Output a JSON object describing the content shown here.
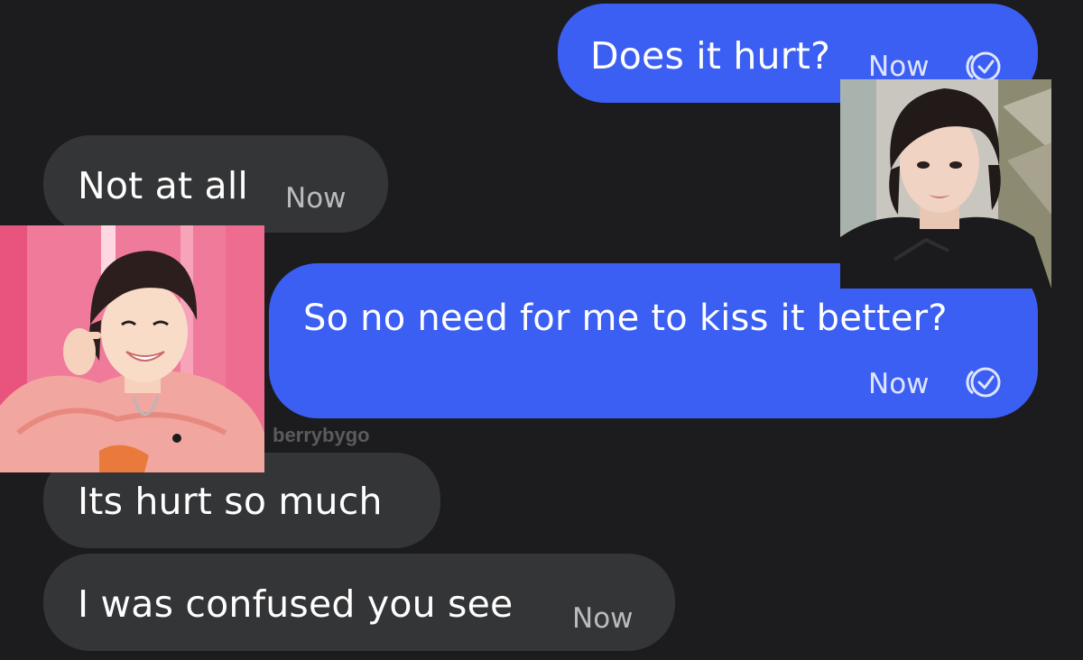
{
  "conversation": {
    "messages": [
      {
        "direction": "sent",
        "text": "Does it hurt?",
        "time": "Now",
        "status_icon": "read-check-icon"
      },
      {
        "direction": "received",
        "text": "Not at all",
        "time": "Now"
      },
      {
        "direction": "sent",
        "text": "So no need for me to kiss it better?",
        "time": "Now",
        "status_icon": "read-check-icon"
      },
      {
        "direction": "received",
        "text": "Its hurt so much",
        "time": ""
      },
      {
        "direction": "received",
        "text": "I was confused you see",
        "time": "Now"
      }
    ]
  },
  "overlay": {
    "watermark": "berrybygo",
    "images": [
      {
        "name": "photo-pink-background",
        "subject": "person in pink knit sweater, smiling"
      },
      {
        "name": "photo-window-background",
        "subject": "person in black top, portrait"
      }
    ]
  },
  "colors": {
    "background": "#1c1c1e",
    "received_bubble": "#343536",
    "sent_bubble": "#3b5ff3",
    "timestamp_received": "#b9bbbe",
    "timestamp_sent": "#dfe5ff"
  }
}
